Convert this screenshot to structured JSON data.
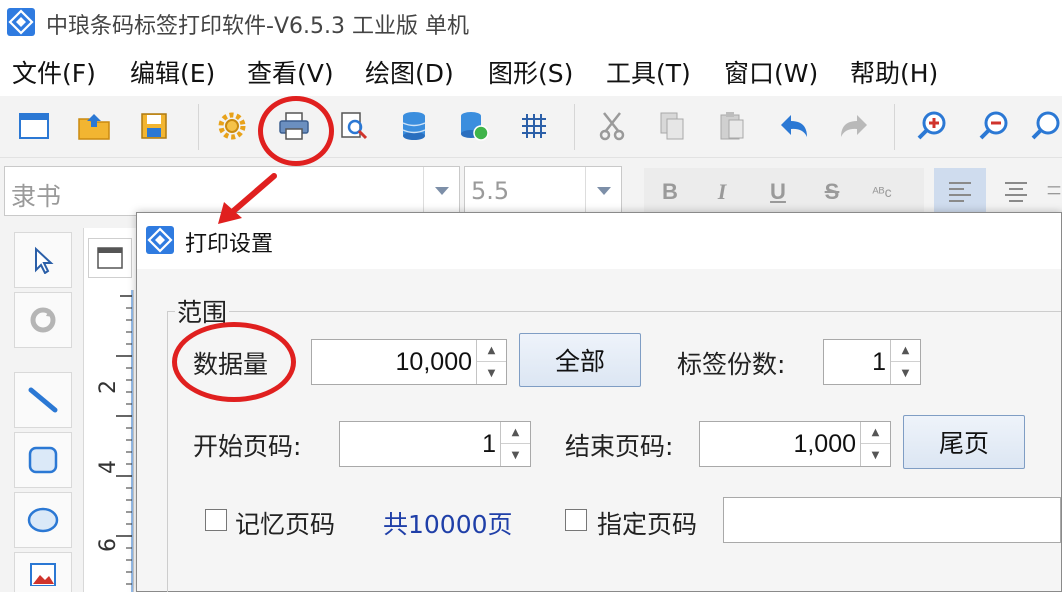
{
  "window": {
    "title": "中琅条码标签打印软件-V6.5.3 工业版 单机",
    "app_icon": "diamond-logo-icon"
  },
  "menu": {
    "items": [
      {
        "label": "文件(F)"
      },
      {
        "label": "编辑(E)"
      },
      {
        "label": "查看(V)"
      },
      {
        "label": "绘图(D)"
      },
      {
        "label": "图形(S)"
      },
      {
        "label": "工具(T)"
      },
      {
        "label": "窗口(W)"
      },
      {
        "label": "帮助(H)"
      }
    ]
  },
  "toolbar": {
    "icons": [
      "new-document-icon",
      "open-folder-icon",
      "save-icon",
      "settings-gear-icon",
      "print-icon",
      "print-preview-icon",
      "database-icon",
      "database-settings-icon",
      "grid-icon",
      "cut-icon",
      "copy-icon",
      "paste-icon",
      "undo-icon",
      "redo-icon",
      "zoom-in-icon",
      "zoom-out-icon",
      "zoom-fit-icon"
    ]
  },
  "format_bar": {
    "font_name": "隶书",
    "font_size": "5.5",
    "bold": "B",
    "italic": "I",
    "underline": "U",
    "strikethrough": "S",
    "superscript": "ᴬᴮc"
  },
  "ruler": {
    "marks": [
      "2",
      "4",
      "6"
    ]
  },
  "dialog": {
    "title": "打印设置",
    "range_group": "范围",
    "data_count_label": "数据量",
    "data_count_value": "10,000",
    "all_button": "全部",
    "copies_label": "标签份数:",
    "copies_value": "1",
    "start_page_label": "开始页码:",
    "start_page_value": "1",
    "end_page_label": "结束页码:",
    "end_page_value": "1,000",
    "last_page_button": "尾页",
    "remember_page_label": "记忆页码",
    "remember_page_checked": false,
    "total_pages": "共10000页",
    "specify_page_label": "指定页码",
    "specify_page_checked": false,
    "specify_page_value": ""
  },
  "colors": {
    "highlight_red": "#e0201f",
    "total_pages_blue": "#1f3fa8",
    "app_icon_blue": "#2f7be0"
  }
}
